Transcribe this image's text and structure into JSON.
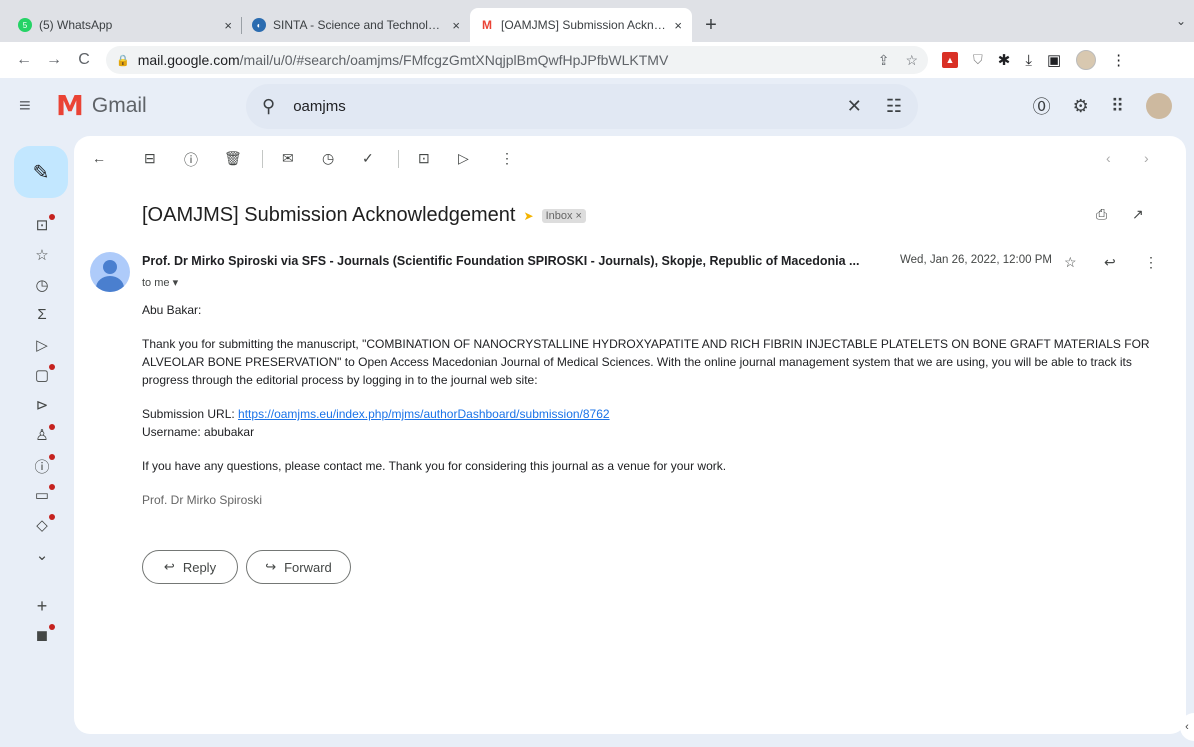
{
  "browser": {
    "tabs": [
      {
        "title": "(5) WhatsApp",
        "close": "×"
      },
      {
        "title": "SINTA - Science and Technology",
        "close": "×"
      },
      {
        "title": "[OAMJMS] Submission Acknowledgement",
        "close": "×"
      }
    ],
    "new_tab": "+",
    "tab_menu": "⌄",
    "url_host": "mail.google.com",
    "url_path": "/mail/u/0/#search/oamjms/FMfcgzGmtXNqjplBmQwfHpJPfbWLKTMV"
  },
  "gmail": {
    "app_name": "Gmail",
    "search_query": "oamjms"
  },
  "email": {
    "subject": "[OAMJMS] Submission Acknowledgement",
    "label": "Inbox ×",
    "sender": "Prof. Dr Mirko Spiroski via SFS - Journals (Scientific Foundation SPIROSKI - Journals), Skopje, Republic of Macedonia ...",
    "date": "Wed, Jan 26, 2022, 12:00 PM",
    "to": "to me ▾",
    "greeting": "Abu Bakar:",
    "paragraph": "Thank you for submitting the manuscript, \"COMBINATION OF NANOCRYSTALLINE HYDROXYAPATITE AND RICH FIBRIN INJECTABLE PLATELETS ON BONE GRAFT MATERIALS FOR ALVEOLAR BONE PRESERVATION\" to Open Access Macedonian Journal of Medical Sciences. With the online journal management system that we are using, you will be able to track its progress through the editorial process by logging in to the journal web site:",
    "submission_label": "Submission URL: ",
    "submission_url": "https://oamjms.eu/index.php/mjms/authorDashboard/submission/8762",
    "username_line": "Username: abubakar",
    "closing": "If you have any questions, please contact me. Thank you for considering this journal as a venue for your work.",
    "signature": "Prof. Dr Mirko Spiroski"
  },
  "actions": {
    "reply": "Reply",
    "forward": "Forward"
  },
  "colors": {
    "accent": "#1a73e8",
    "compose_bg": "#c2e7ff",
    "unread_dot": "#c5221f",
    "page_bg": "#e8eef7"
  }
}
